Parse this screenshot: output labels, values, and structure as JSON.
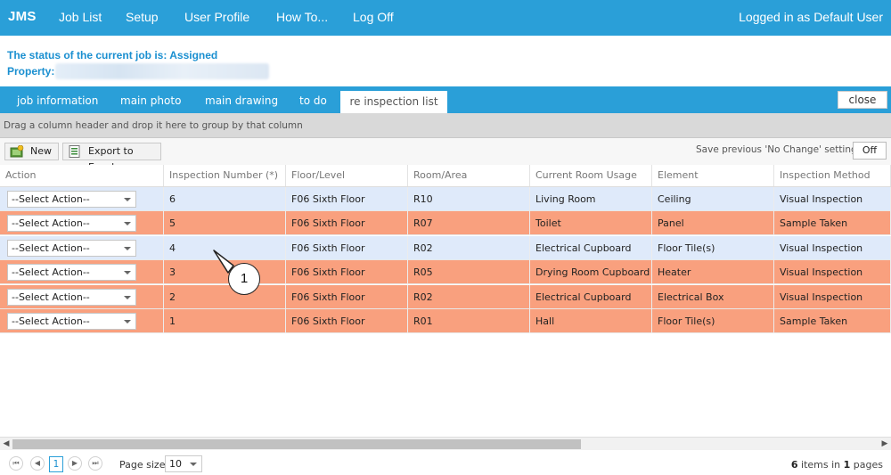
{
  "nav": {
    "brand": "JMS",
    "items": [
      "Job List",
      "Setup",
      "User Profile",
      "How To...",
      "Log Off"
    ],
    "logged_in": "Logged in as Default User"
  },
  "status": {
    "line": "The status of the current job is: Assigned",
    "property_label": "Property:"
  },
  "tabs": [
    "job information",
    "main photo",
    "main drawing",
    "to do",
    "re inspection list"
  ],
  "active_tab": "re inspection list",
  "close_label": "close",
  "group_panel_text": "Drag a column header and drop it here to group by that column",
  "toolbar": {
    "new_label": "New",
    "export_label": "Export to Excel",
    "save_previous_label": "Save previous 'No Change' settings:",
    "off_label": "Off"
  },
  "columns": [
    "Action",
    "Inspection Number (*)",
    "Floor/Level",
    "Room/Area",
    "Current Room Usage",
    "Element",
    "Inspection Method"
  ],
  "rows": [
    {
      "action": "--Select Action--",
      "number": "6",
      "floor": "F06 Sixth Floor",
      "room": "R10",
      "usage": "Living Room",
      "element": "Ceiling",
      "method": "Visual Inspection",
      "style": "blue"
    },
    {
      "action": "--Select Action--",
      "number": "5",
      "floor": "F06 Sixth Floor",
      "room": "R07",
      "usage": "Toilet",
      "element": "Panel",
      "method": "Sample Taken",
      "style": "orange"
    },
    {
      "action": "--Select Action--",
      "number": "4",
      "floor": "F06 Sixth Floor",
      "room": "R02",
      "usage": "Electrical Cupboard",
      "element": "Floor Tile(s)",
      "method": "Visual Inspection",
      "style": "blue"
    },
    {
      "action": "--Select Action--",
      "number": "3",
      "floor": "F06 Sixth Floor",
      "room": "R05",
      "usage": "Drying Room Cupboard",
      "element": "Heater",
      "method": "Visual Inspection",
      "style": "orange"
    },
    {
      "action": "--Select Action--",
      "number": "2",
      "floor": "F06 Sixth Floor",
      "room": "R02",
      "usage": "Electrical Cupboard",
      "element": "Electrical Box",
      "method": "Visual Inspection",
      "style": "orange"
    },
    {
      "action": "--Select Action--",
      "number": "1",
      "floor": "F06 Sixth Floor",
      "room": "R01",
      "usage": "Hall",
      "element": "Floor Tile(s)",
      "method": "Sample Taken",
      "style": "orange"
    }
  ],
  "row_colors": {
    "blue": "#dfeafa",
    "orange": "#f9a07e"
  },
  "callout": "1",
  "pager": {
    "current_page": "1",
    "page_size_label": "Page size:",
    "page_size": "10",
    "items_count": "6",
    "items_text": "items in",
    "pages_count": "1",
    "pages_text": "pages"
  },
  "colors": {
    "accent": "#2a9fd8",
    "status_text": "#1a8fd0"
  }
}
